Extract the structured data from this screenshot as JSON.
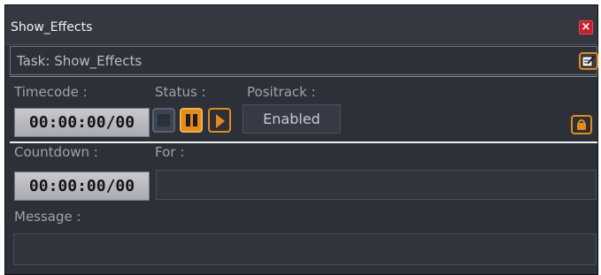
{
  "window": {
    "title": "Show_Effects"
  },
  "task": {
    "label": "Task:  Show_Effects"
  },
  "timecode": {
    "label": "Timecode :",
    "value": "00:00:00/00"
  },
  "status": {
    "label": "Status :"
  },
  "positrack": {
    "label": "Positrack :",
    "value": "Enabled"
  },
  "countdown": {
    "label": "Countdown :",
    "value": "00:00:00/00"
  },
  "for": {
    "label": "For :",
    "value": ""
  },
  "message": {
    "label": "Message :",
    "value": ""
  },
  "icons": {
    "close": "close-icon",
    "edit": "edit-note-icon",
    "stop": "stop-icon",
    "pause": "pause-icon",
    "play": "play-icon",
    "lock": "lock-icon"
  },
  "colors": {
    "accent": "#e68a17",
    "background": "#2c3039",
    "close": "#c8202a"
  }
}
